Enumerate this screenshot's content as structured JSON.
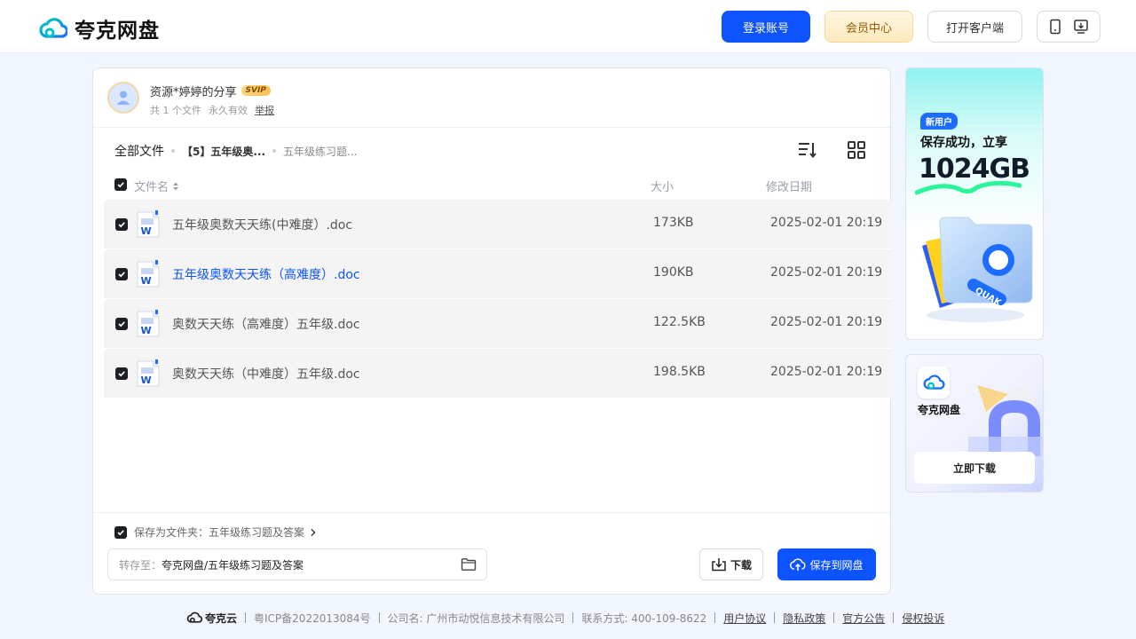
{
  "header": {
    "logo_text": "夸克网盘",
    "login_label": "登录账号",
    "vip_label": "会员中心",
    "client_label": "打开客户端"
  },
  "share": {
    "sharer_name": "资源*婷婷的分享",
    "svip_badge": "SVIP",
    "file_count": "共 1 个文件",
    "validity": "永久有效",
    "report": "举报"
  },
  "breadcrumb": [
    "全部文件",
    "【5】五年级奥...",
    "五年级练习题..."
  ],
  "table": {
    "col_name": "文件名",
    "col_size": "大小",
    "col_date": "修改日期",
    "rows": [
      {
        "name": "五年级奥数天天练(中难度）.doc",
        "size": "173KB",
        "date": "2025-02-01 20:19"
      },
      {
        "name": "五年级奥数天天练（高难度）.doc",
        "size": "190KB",
        "date": "2025-02-01 20:19"
      },
      {
        "name": "奥数天天练（高难度）五年级.doc",
        "size": "122.5KB",
        "date": "2025-02-01 20:19"
      },
      {
        "name": "奥数天天练（中难度）五年级.doc",
        "size": "198.5KB",
        "date": "2025-02-01 20:19"
      }
    ]
  },
  "bottom": {
    "save_as_folder": "保存为文件夹：五年级练习题及答案",
    "dest_label": "转存至：",
    "dest_path": "夸克网盘/五年级练习题及答案",
    "download_label": "下载",
    "save_label": "保存到网盘"
  },
  "ads": {
    "ad1_badge": "新用户",
    "ad1_line1": "保存成功，立享",
    "ad1_line2": "1024GB",
    "ad1_folder_text": "QUAK",
    "ad2_name": "夸克网盘",
    "ad2_button": "立即下载"
  },
  "footer": {
    "brand": "夸克云",
    "icp": "粤ICP备2022013084号",
    "company": "公司名: 广州市动悦信息技术有限公司",
    "contact": "联系方式: 400-109-8622",
    "links": [
      "用户协议",
      "隐私政策",
      "官方公告",
      "侵权投诉"
    ]
  },
  "colors": {
    "accent": "#0d53ff",
    "background": "#f1f5fd"
  }
}
